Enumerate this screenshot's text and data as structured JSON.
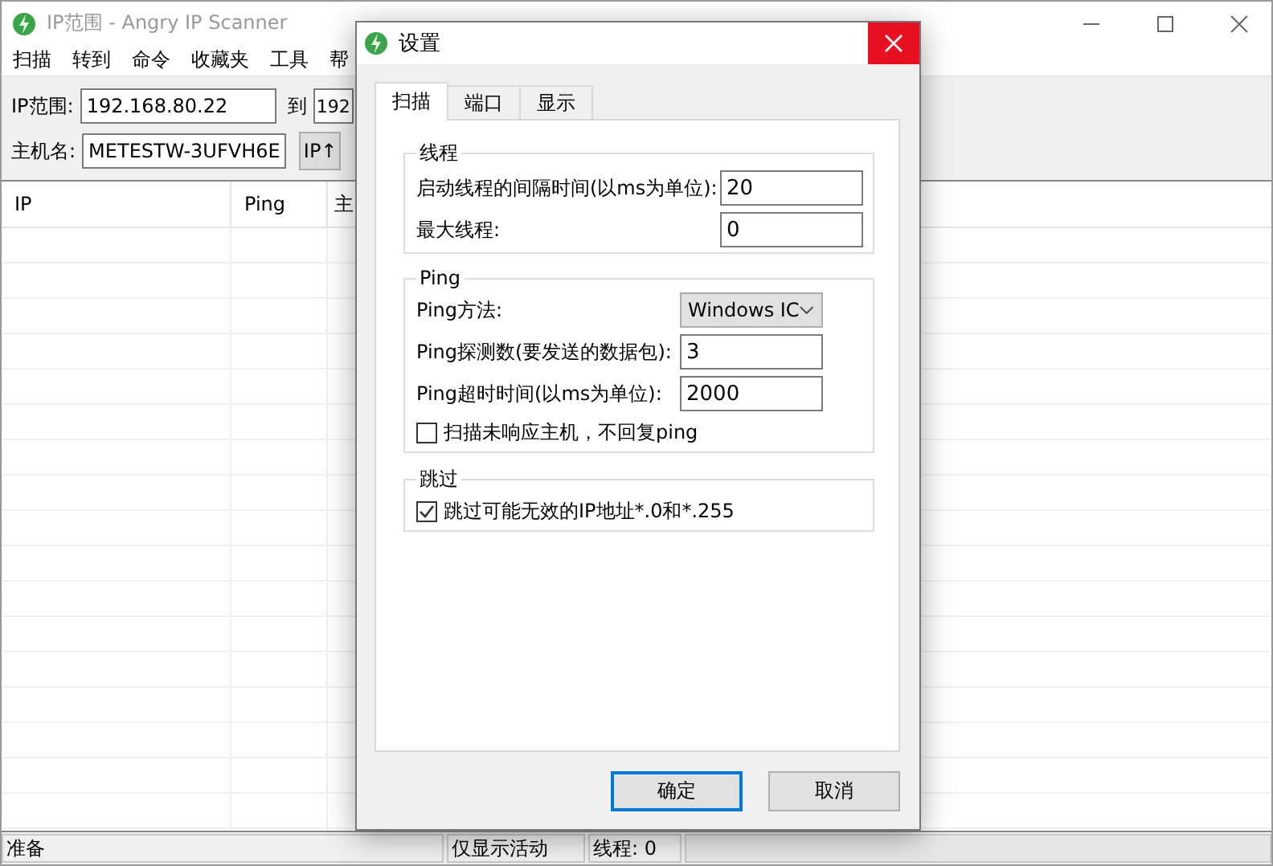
{
  "window": {
    "title": "IP范围 - Angry IP Scanner"
  },
  "menu": [
    "扫描",
    "转到",
    "命令",
    "收藏夹",
    "工具",
    "帮"
  ],
  "toolbar": {
    "range_label": "IP范围:",
    "range_start": "192.168.80.22",
    "to_label": "到",
    "range_end": "192",
    "host_label": "主机名:",
    "host_value": "METESTW-3UFVH6E",
    "ip_button": "IP↑"
  },
  "table": {
    "columns": [
      "IP",
      "Ping",
      "主"
    ]
  },
  "status_bar": [
    "准备",
    "仅显示活动",
    "线程: 0"
  ],
  "dialog": {
    "title": "设置",
    "tabs": [
      {
        "label": "扫描",
        "selected": true
      },
      {
        "label": "端口",
        "selected": false
      },
      {
        "label": "显示",
        "selected": false
      }
    ],
    "groups": [
      {
        "title": "线程",
        "rows": [
          {
            "kind": "field",
            "label": "启动线程的间隔时间(以ms为单位):",
            "value": "20"
          },
          {
            "kind": "field",
            "label": "最大线程:",
            "value": "0"
          }
        ]
      },
      {
        "title": "Ping",
        "rows": [
          {
            "kind": "select",
            "label": "Ping方法:",
            "value": "Windows IC"
          },
          {
            "kind": "field",
            "label": "Ping探测数(要发送的数据包):",
            "value": "3"
          },
          {
            "kind": "field",
            "label": "Ping超时时间(以ms为单位):",
            "value": "2000"
          },
          {
            "kind": "checkbox",
            "label": "扫描未响应主机，不回复ping",
            "checked": false
          }
        ]
      },
      {
        "title": "跳过",
        "rows": [
          {
            "kind": "checkbox",
            "label": "跳过可能无效的IP地址*.0和*.255",
            "checked": true
          }
        ]
      }
    ],
    "buttons": [
      {
        "label": "确定",
        "default": true
      },
      {
        "label": "取消",
        "default": false
      }
    ]
  }
}
